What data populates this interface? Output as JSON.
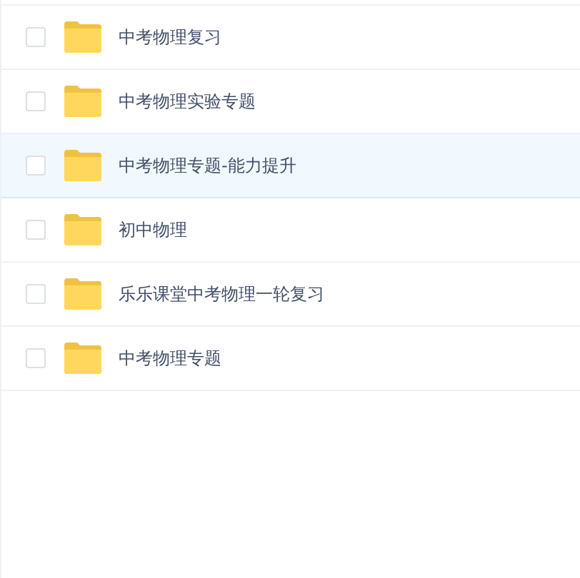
{
  "files": [
    {
      "name": "中考物理复习",
      "checked": false,
      "selected": false
    },
    {
      "name": "中考物理实验专题",
      "checked": false,
      "selected": false
    },
    {
      "name": "中考物理专题-能力提升",
      "checked": false,
      "selected": true
    },
    {
      "name": "初中物理",
      "checked": false,
      "selected": false
    },
    {
      "name": "乐乐课堂中考物理一轮复习",
      "checked": false,
      "selected": false
    },
    {
      "name": "中考物理专题",
      "checked": false,
      "selected": false
    }
  ]
}
